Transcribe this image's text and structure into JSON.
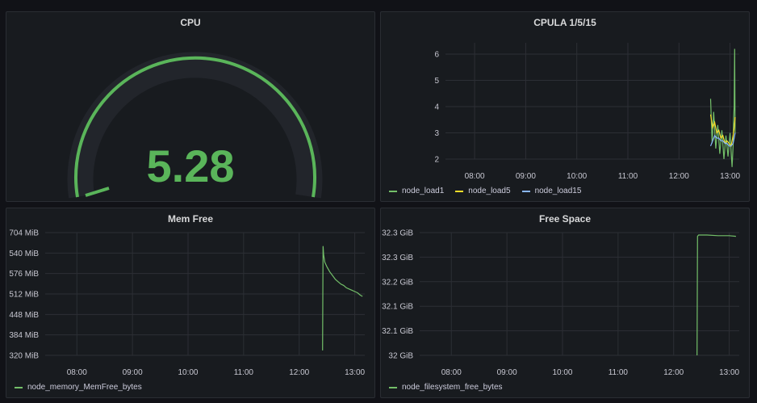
{
  "panels": {
    "cpu": {
      "title": "CPU",
      "value": "5.28",
      "gauge_fraction": 0.053,
      "color": "#5ab55a"
    },
    "load": {
      "title": "CPULA 1/5/15",
      "legend": [
        {
          "name": "node_load1",
          "color": "#73bf69"
        },
        {
          "name": "node_load5",
          "color": "#fade2a"
        },
        {
          "name": "node_load15",
          "color": "#8ab8ff"
        }
      ]
    },
    "mem": {
      "title": "Mem Free",
      "legend": [
        {
          "name": "node_memory_MemFree_bytes",
          "color": "#73bf69"
        }
      ]
    },
    "disk": {
      "title": "Free Space",
      "legend": [
        {
          "name": "node_filesystem_free_bytes",
          "color": "#73bf69"
        }
      ]
    }
  },
  "chart_data": [
    {
      "id": "load",
      "type": "line",
      "title": "CPULA 1/5/15",
      "x_ticks": [
        "08:00",
        "09:00",
        "10:00",
        "11:00",
        "12:00",
        "13:00"
      ],
      "y_ticks": [
        "2",
        "3",
        "4",
        "5",
        "6"
      ],
      "ylim": [
        1.5,
        6.5
      ],
      "series": [
        {
          "name": "node_load1",
          "color": "#73bf69",
          "x": [
            12.62,
            12.65,
            12.68,
            12.72,
            12.76,
            12.8,
            12.84,
            12.88,
            12.92,
            12.96,
            13.0,
            13.04,
            13.06,
            13.07,
            13.08,
            13.09,
            13.1
          ],
          "y": [
            4.3,
            2.6,
            3.8,
            2.4,
            3.3,
            2.2,
            3.1,
            2.0,
            2.9,
            2.1,
            3.0,
            1.7,
            2.5,
            3.5,
            4.0,
            6.2,
            3.0
          ]
        },
        {
          "name": "node_load5",
          "color": "#fade2a",
          "x": [
            12.62,
            12.66,
            12.7,
            12.74,
            12.78,
            12.82,
            12.86,
            12.9,
            12.94,
            12.98,
            13.02,
            13.06,
            13.08,
            13.1
          ],
          "y": [
            3.7,
            3.2,
            3.4,
            3.0,
            3.1,
            2.8,
            2.9,
            2.6,
            2.7,
            2.6,
            2.5,
            2.9,
            3.2,
            3.6
          ]
        },
        {
          "name": "node_load15",
          "color": "#8ab8ff",
          "x": [
            12.62,
            12.66,
            12.7,
            12.74,
            12.78,
            12.82,
            12.86,
            12.9,
            12.94,
            12.98,
            13.02,
            13.06,
            13.08,
            13.1
          ],
          "y": [
            2.5,
            2.7,
            2.9,
            2.8,
            2.8,
            2.7,
            2.7,
            2.6,
            2.6,
            2.5,
            2.5,
            2.6,
            2.8,
            3.0
          ]
        }
      ]
    },
    {
      "id": "mem",
      "type": "line",
      "title": "Mem Free",
      "x_ticks": [
        "08:00",
        "09:00",
        "10:00",
        "11:00",
        "12:00",
        "13:00"
      ],
      "y_ticks": [
        "320 MiB",
        "384 MiB",
        "448 MiB",
        "512 MiB",
        "576 MiB",
        "540 MiB",
        "704 MiB"
      ],
      "series": [
        {
          "name": "node_memory_MemFree_bytes",
          "color": "#73bf69",
          "x": [
            12.42,
            12.43,
            12.44,
            12.46,
            12.5,
            12.55,
            12.6,
            12.65,
            12.7,
            12.75,
            12.8,
            12.85,
            12.9,
            12.95,
            13.0,
            13.05,
            13.1,
            13.14
          ],
          "y": [
            0.04,
            0.89,
            0.82,
            0.76,
            0.72,
            0.68,
            0.65,
            0.62,
            0.6,
            0.58,
            0.57,
            0.55,
            0.54,
            0.53,
            0.52,
            0.51,
            0.49,
            0.48
          ]
        }
      ]
    },
    {
      "id": "disk",
      "type": "line",
      "title": "Free Space",
      "x_ticks": [
        "08:00",
        "09:00",
        "10:00",
        "11:00",
        "12:00",
        "13:00"
      ],
      "y_ticks": [
        "32 GiB",
        "32.1 GiB",
        "32.1 GiB",
        "32.2 GiB",
        "32.3 GiB",
        "32.3 GiB"
      ],
      "series": [
        {
          "name": "node_filesystem_free_bytes",
          "color": "#73bf69",
          "x": [
            12.42,
            12.43,
            12.45,
            12.6,
            12.8,
            13.0,
            13.12
          ],
          "y": [
            0.0,
            0.97,
            0.98,
            0.98,
            0.975,
            0.975,
            0.97
          ]
        }
      ]
    }
  ]
}
